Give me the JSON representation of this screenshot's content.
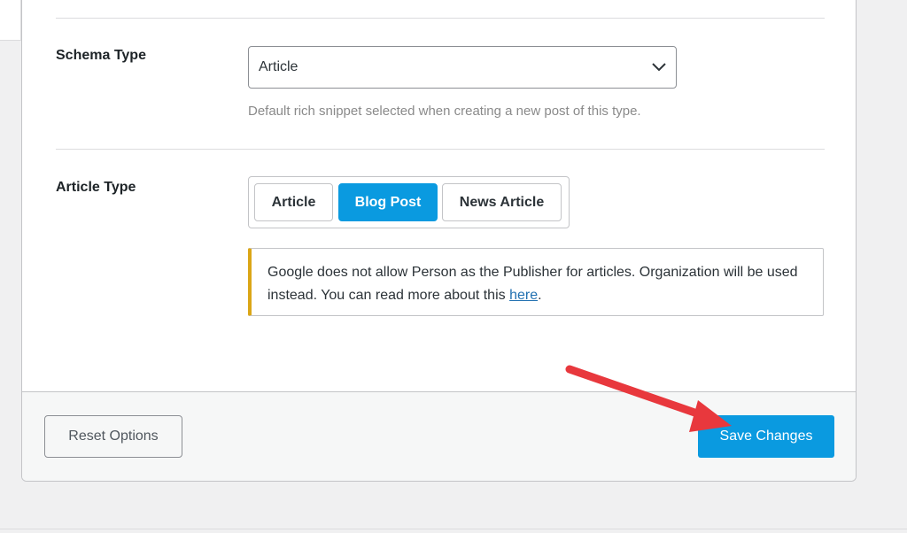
{
  "schema_type": {
    "label": "Schema Type",
    "selected": "Article",
    "help": "Default rich snippet selected when creating a new post of this type."
  },
  "article_type": {
    "label": "Article Type",
    "options": [
      "Article",
      "Blog Post",
      "News Article"
    ],
    "selected": "Blog Post"
  },
  "notice": {
    "text": "Google does not allow Person as the Publisher for articles. Organization will be used instead. You can read more about this ",
    "link_text": "here",
    "end": ".",
    "accent_color": "#dba617"
  },
  "footer": {
    "reset_label": "Reset Options",
    "save_label": "Save Changes"
  },
  "colors": {
    "primary": "#0a9ae0",
    "annotation_arrow": "#e8383d"
  },
  "icons": {
    "select_chevron": "chevron-down-icon",
    "annotation": "arrow-pointer-annotation"
  }
}
